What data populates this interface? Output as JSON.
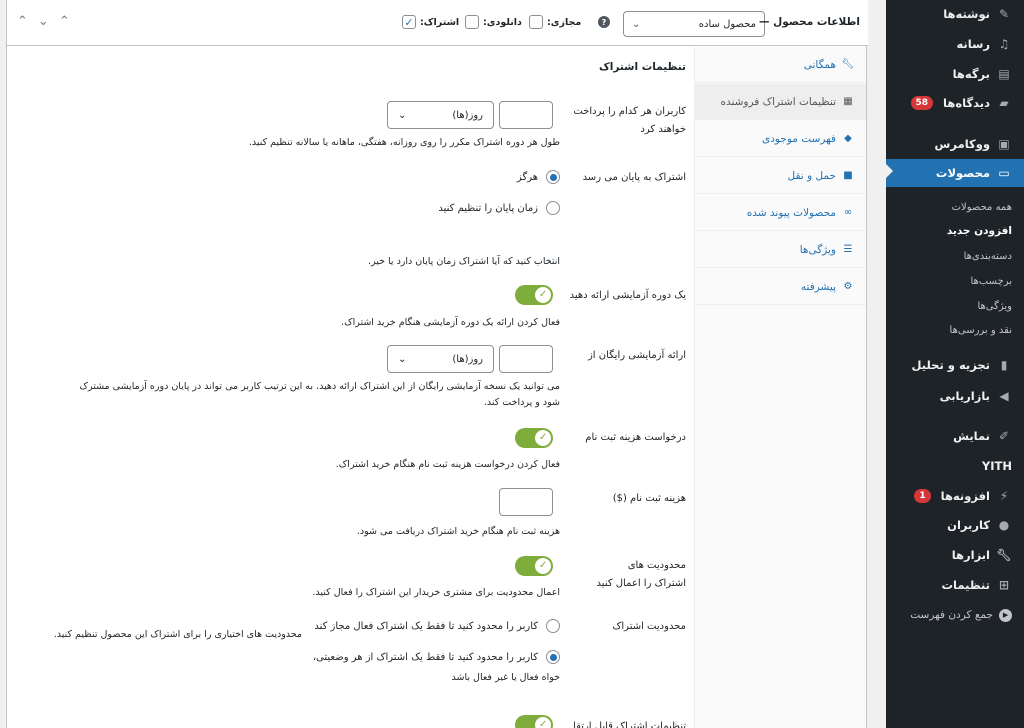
{
  "header": {
    "title": "اطلاعات محصول —",
    "product_type": "محصول ساده",
    "help_symbol": "?",
    "checks": [
      {
        "label": "اشتراک:",
        "checked": true
      },
      {
        "label": "مجازی:",
        "checked": false
      },
      {
        "label": "دانلودی:",
        "checked": false
      }
    ]
  },
  "tabs": [
    {
      "label": "همگانی",
      "icon": "wrench-icon"
    },
    {
      "label": "تنظیمات اشتراک فروشنده",
      "icon": "settings-panel-icon",
      "active": true
    },
    {
      "label": "فهرست موجودی",
      "icon": "tag-icon"
    },
    {
      "label": "حمل و نقل",
      "icon": "truck-icon"
    },
    {
      "label": "محصولات پیوند شده",
      "icon": "link-icon"
    },
    {
      "label": "ویژگی‌ها",
      "icon": "list-icon"
    },
    {
      "label": "پیشرفته",
      "icon": "gear-icon"
    }
  ],
  "panel": {
    "title": "تنظیمات اشتراک",
    "billing_label": "کاربران هر کدام را پرداخت خواهند کرد",
    "billing_period_value": "روز(ها)",
    "billing_desc": "طول هر دوره اشتراک مکرر را روی روزانه، هفتگی، ماهانه یا سالانه تنظیم کنید.",
    "ends_label": "اشتراک به پایان می رسد",
    "ends_never": "هرگز",
    "ends_set": "زمان پایان را تنظیم کنید",
    "ends_desc": "انتخاب کنید که آیا اشتراک زمان پایان دارد یا خیر.",
    "trial_label": "یک دوره آزمایشی ارائه دهید",
    "trial_desc": "فعال کردن ارائه یک دوره آزمایشی هنگام خرید اشتراک.",
    "free_trial_label": "ارائه آزمایشی رایگان از",
    "free_trial_period_value": "روز(ها)",
    "free_trial_desc": "می توانید یک نسخه آزمایشی رایگان از این اشتراک ارائه دهید. به این ترتیب کاربر می تواند در پایان دوره آزمایشی مشترک شود و پرداخت کند.",
    "signup_label": "درخواست هزینه ثبت نام",
    "signup_desc": "فعال کردن درخواست هزینه ثبت نام هنگام خرید اشتراک.",
    "signup_fee_label": "هزینه ثبت نام ($)",
    "signup_fee_desc": "هزینه ثبت نام هنگام خرید اشتراک دریافت می شود.",
    "limits_label": "محدودیت های اشتراک را اعمال کنید",
    "limits_desc": "اعمال محدودیت برای مشتری خریدار این اشتراک را فعال کنید.",
    "limit_type_label": "محدودیت اشتراک",
    "limit_opt1": "کاربر را محدود کنید تا فقط یک اشتراک فعال مجاز کند",
    "limit_opt2": "کاربر را محدود کنید تا فقط یک اشتراک از هر وضعیتی،",
    "limit_opt2b": "خواه فعال یا غیر فعال باشد",
    "limit_side_desc": "محدودیت های اختیاری را برای اشتراک این محصول تنظیم کنید.",
    "bottom_cut_label": "تنظیمات اشتراک قابل ارتقا"
  },
  "menu": {
    "items": [
      {
        "label": "نوشته‌ها",
        "icon": "pin-icon"
      },
      {
        "label": "رسانه",
        "icon": "media-icon"
      },
      {
        "label": "برگه‌ها",
        "icon": "pages-icon"
      },
      {
        "label": "دیدگاه‌ها",
        "icon": "comment-icon",
        "badge": "58"
      },
      {
        "label": "ووکامرس",
        "icon": "woo-icon"
      },
      {
        "label": "محصولات",
        "icon": "archive-icon",
        "current": true
      },
      {
        "label": "تجزیه و تحلیل",
        "icon": "chart-icon"
      },
      {
        "label": "بازاریابی",
        "icon": "megaphone-icon"
      },
      {
        "label": "نمایش",
        "icon": "brush-icon"
      },
      {
        "label": "YITH",
        "icon": "yith-icon"
      },
      {
        "label": "افزونه‌ها",
        "icon": "plugin-icon",
        "badge": "1"
      },
      {
        "label": "کاربران",
        "icon": "user-icon"
      },
      {
        "label": "ابزارها",
        "icon": "tools-icon"
      },
      {
        "label": "تنظیمات",
        "icon": "settings-icon"
      }
    ],
    "sub_items": [
      {
        "label": "همه محصولات"
      },
      {
        "label": "افزودن جدید",
        "current": true
      },
      {
        "label": "دسته‌بندی‌ها"
      },
      {
        "label": "برچسب‌ها"
      },
      {
        "label": "ویژگی‌ها"
      },
      {
        "label": "نقد و بررسی‌ها"
      }
    ],
    "collapse_label": "جمع کردن فهرست"
  }
}
